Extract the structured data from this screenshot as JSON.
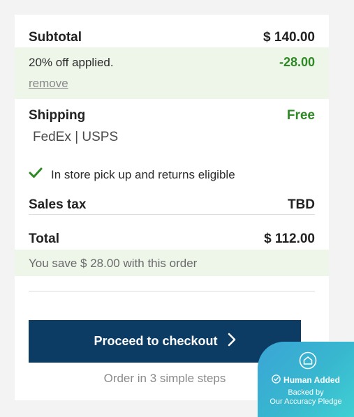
{
  "summary": {
    "subtotal_label": "Subtotal",
    "subtotal_value": "$ 140.00",
    "discount_text": "20% off applied.",
    "discount_value": "-28.00",
    "remove_label": "remove",
    "shipping_label": "Shipping",
    "shipping_value": "Free",
    "carriers": "FedEx | USPS",
    "pickup_text": "In store pick up and returns eligible",
    "tax_label": "Sales tax",
    "tax_value": "TBD",
    "total_label": "Total",
    "total_value": "$ 112.00",
    "savings_text": "You save $ 28.00 with this order"
  },
  "checkout": {
    "button_label": "Proceed to checkout",
    "steps_text": "Order in 3 simple steps"
  },
  "badge": {
    "title": "Human Added",
    "line1": "Backed by",
    "line2": "Our Accuracy Pledge"
  },
  "colors": {
    "accent_green": "#2e8a25",
    "button_navy": "#0c3b63",
    "highlight_bg": "#eef6ea",
    "badge_teal": "#3fd0d4"
  },
  "icons": {
    "pickup": "check-icon",
    "checkout": "chevron-right-icon",
    "badge_top": "home-shield-icon",
    "badge_title": "check-circle-icon"
  }
}
